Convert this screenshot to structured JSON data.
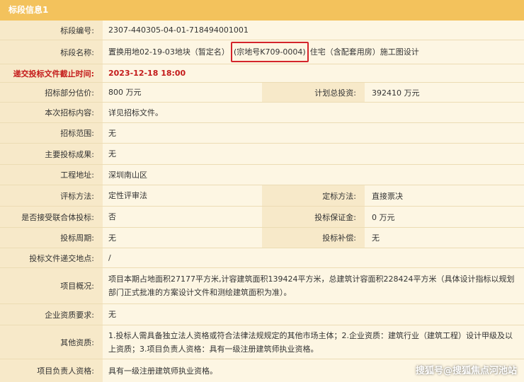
{
  "header": {
    "title": "标段信息1"
  },
  "rows": {
    "section_no": {
      "label": "标段编号:",
      "value": "2307-440305-04-01-718494001001"
    },
    "section_name": {
      "label": "标段名称:",
      "value_pre": "置换用地02-19-03地块（暂定名）",
      "value_hl": "(宗地号K709-0004)",
      "value_post": "住宅（含配套用房）施工图设计"
    },
    "deadline": {
      "label": "递交投标文件截止时间:",
      "value": "2023-12-18 18:00"
    },
    "bid_price": {
      "label": "招标部分估价:",
      "value": "800 万元",
      "label2": "计划总投资:",
      "value2": "392410 万元"
    },
    "content": {
      "label": "本次招标内容:",
      "value": "详见招标文件。"
    },
    "scope": {
      "label": "招标范围:",
      "value": "无"
    },
    "results": {
      "label": "主要投标成果:",
      "value": "无"
    },
    "address": {
      "label": "工程地址:",
      "value": "深圳南山区"
    },
    "eval": {
      "label": "评标方法:",
      "value": "定性评审法",
      "label2": "定标方法:",
      "value2": "直接票决"
    },
    "consortium": {
      "label": "是否接受联合体投标:",
      "value": "否",
      "label2": "投标保证金:",
      "value2": "0 万元"
    },
    "period": {
      "label": "投标周期:",
      "value": "无",
      "label2": "投标补偿:",
      "value2": "无"
    },
    "submit_place": {
      "label": "投标文件递交地点:",
      "value": "/"
    },
    "overview": {
      "label": "项目概况:",
      "value": "项目本期占地面积27177平方米,计容建筑面积139424平方米，总建筑计容面积228424平方米（具体设计指标以规划部门正式批准的方案设计文件和测绘建筑面积为准）。"
    },
    "qual_req": {
      "label": "企业资质要求:",
      "value": "无"
    },
    "other_qual": {
      "label": "其他资质:",
      "value": "1.投标人需具备独立法人资格或符合法律法规规定的其他市场主体；2.企业资质：建筑行业（建筑工程）设计甲级及以上资质；3.项目负责人资格：具有一级注册建筑师执业资格。"
    },
    "leader_qual": {
      "label": "项目负责人资格:",
      "value": "具有一级注册建筑师执业资格。"
    }
  },
  "watermark": "搜狐号@搜狐焦点河池站",
  "colors": {
    "header": "#f3c25c",
    "label_bg": "#f7e9c9",
    "value_bg": "#fdf6e3",
    "highlight": "#d4242a",
    "deadline_text": "#c41a1a"
  }
}
